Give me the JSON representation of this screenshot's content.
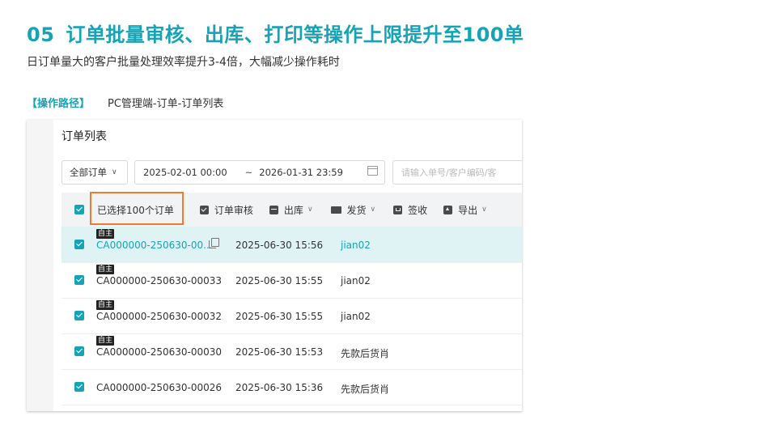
{
  "slide": {
    "number": "05",
    "title": "订单批量审核、出库、打印等操作上限提升至100单",
    "subtitle": "日订单量大的客户批量处理效率提升3-4倍，大幅减少操作耗时",
    "path_tag": "【操作路径】",
    "path_value": "PC管理端-订单-订单列表"
  },
  "panel": {
    "title": "订单列表",
    "filter_select": "全部订单",
    "date_start": "2025-02-01 00:00",
    "date_sep": "~",
    "date_end": "2026-01-31 23:59",
    "search_placeholder": "请输入单号/客户编码/客"
  },
  "toolbar": {
    "selected": "已选择100个订单",
    "buttons": [
      {
        "label": "订单审核",
        "icon": "check-square-icon",
        "dropdown": false
      },
      {
        "label": "出库",
        "icon": "box-icon",
        "dropdown": true
      },
      {
        "label": "发货",
        "icon": "truck-icon",
        "dropdown": true
      },
      {
        "label": "签收",
        "icon": "bag-icon",
        "dropdown": false
      },
      {
        "label": "导出",
        "icon": "upload-icon",
        "dropdown": true
      }
    ]
  },
  "rows": [
    {
      "badge": "自主",
      "order": "CA000000-250630-00...",
      "time": "2025-06-30 15:56",
      "customer": "jian02",
      "active": true
    },
    {
      "badge": "自主",
      "order": "CA000000-250630-00033",
      "time": "2025-06-30 15:55",
      "customer": "jian02",
      "active": false
    },
    {
      "badge": "自主",
      "order": "CA000000-250630-00032",
      "time": "2025-06-30 15:55",
      "customer": "jian02",
      "active": false
    },
    {
      "badge": "自主",
      "order": "CA000000-250630-00030",
      "time": "2025-06-30 15:53",
      "customer": "先款后货肖",
      "active": false
    },
    {
      "badge": "",
      "order": "CA000000-250630-00026",
      "time": "2025-06-30 15:36",
      "customer": "先款后货肖",
      "active": false
    }
  ],
  "colors": {
    "accent": "#17a3b6",
    "highlight": "#f07b2f"
  }
}
